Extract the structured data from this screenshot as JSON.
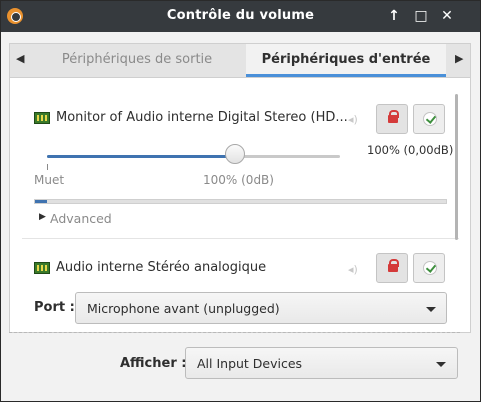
{
  "window": {
    "title": "Contrôle du volume",
    "app_icon": "pavucontrol-icon",
    "controls": {
      "up": "↑",
      "maximize": "□",
      "close": "✕"
    }
  },
  "tabs": {
    "left_arrow": "◀",
    "right_arrow": "▶",
    "items": [
      {
        "label": "Périphériques de sortie",
        "active": false
      },
      {
        "label": "Périphériques d'entrée",
        "active": true
      }
    ]
  },
  "devices": [
    {
      "name": "Monitor of Audio interne Digital Stereo (HD...",
      "volume_text": "100% (0,00dB)",
      "volume_fraction": 0.64,
      "level_fraction": 0.03,
      "scale_min_label": "Muet",
      "scale_mark_label": "100% (0dB)",
      "advanced_label": "Advanced",
      "mute_icon": "lock-icon",
      "default_icon": "check-icon"
    },
    {
      "name": "Audio interne Stéréo analogique",
      "port_label": "Port :",
      "port_value": "Microphone avant (unplugged)",
      "mute_icon": "lock-icon",
      "default_icon": "check-icon"
    }
  ],
  "footer": {
    "show_label": "Afficher :",
    "show_value": "All Input Devices"
  },
  "colors": {
    "titlebar": "#363a3e",
    "accent": "#3f73b0",
    "lock": "#d43a3a",
    "check": "#3e8f3e"
  }
}
